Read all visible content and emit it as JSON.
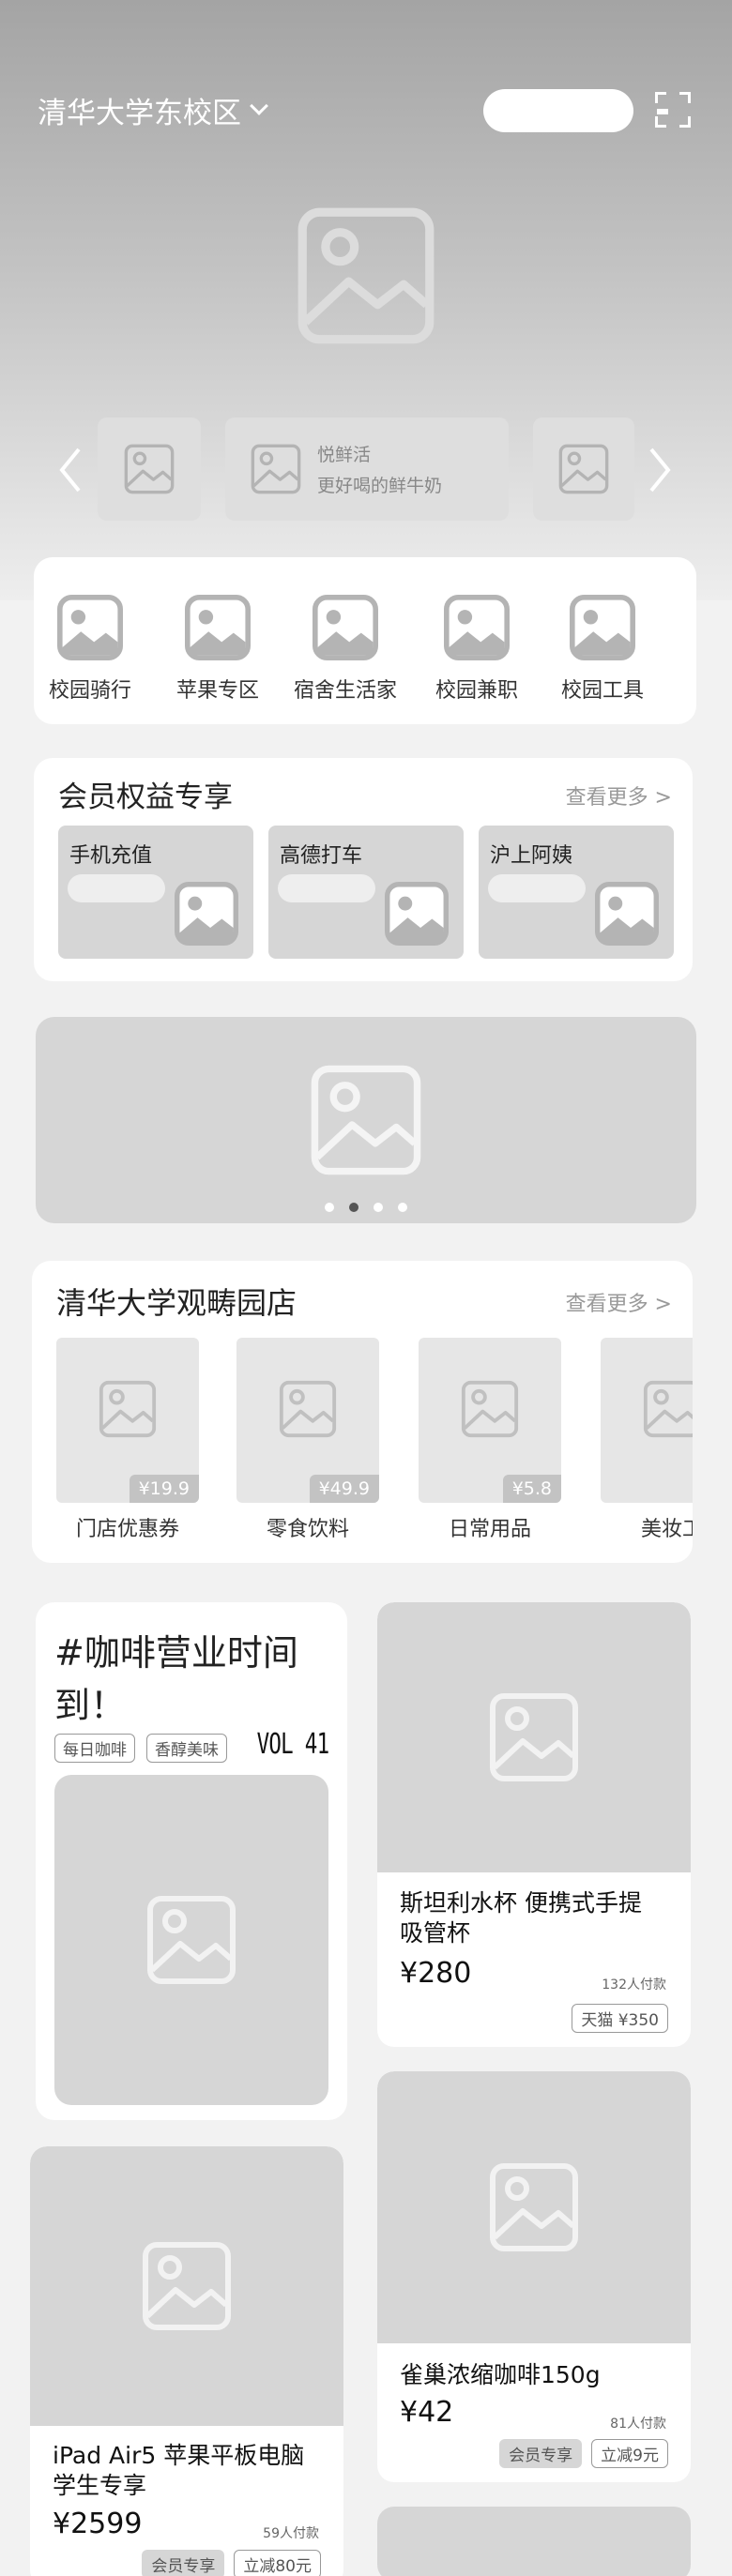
{
  "header": {
    "campus": "清华大学东校区"
  },
  "carousel": {
    "promo_title": "悦鲜活",
    "promo_subtitle": "更好喝的鲜牛奶"
  },
  "categories": [
    {
      "label": "校园骑行",
      "icon": "image-placeholder-icon"
    },
    {
      "label": "苹果专区",
      "icon": "image-placeholder-icon"
    },
    {
      "label": "宿舍生活家",
      "icon": "image-placeholder-icon"
    },
    {
      "label": "校园兼职",
      "icon": "image-placeholder-icon"
    },
    {
      "label": "校园工具",
      "icon": "image-placeholder-icon"
    }
  ],
  "member": {
    "title": "会员权益专享",
    "more": "查看更多 >",
    "cards": [
      {
        "label": "手机充值"
      },
      {
        "label": "高德打车"
      },
      {
        "label": "沪上阿姨"
      }
    ]
  },
  "banner": {
    "dots": 4,
    "active_dot": 1
  },
  "store": {
    "title": "清华大学观畴园店",
    "more": "查看更多 >",
    "items": [
      {
        "name": "门店优惠券",
        "price": "¥19.9"
      },
      {
        "name": "零食饮料",
        "price": "¥49.9"
      },
      {
        "name": "日常用品",
        "price": "¥5.8"
      },
      {
        "name": "美妆工",
        "price": ""
      }
    ]
  },
  "coffee": {
    "title": "#咖啡营业时间到！",
    "tags": [
      "每日咖啡",
      "香醇美味"
    ],
    "vol": "VOL 41"
  },
  "products": [
    {
      "name": "斯坦利水杯 便携式手提吸管杯",
      "price": "¥280",
      "sold": "132人付款",
      "badges": [
        {
          "text": "天猫 ¥350",
          "style": "line"
        }
      ]
    },
    {
      "name": "iPad Air5 苹果平板电脑学生专享",
      "price": "¥2599",
      "sold": "59人付款",
      "badges": [
        {
          "text": "会员专享",
          "style": "fill"
        },
        {
          "text": "立减80元",
          "style": "line"
        }
      ]
    },
    {
      "name": "雀巢浓缩咖啡150g",
      "price": "¥42",
      "sold": "81人付款",
      "badges": [
        {
          "text": "会员专享",
          "style": "fill"
        },
        {
          "text": "立减9元",
          "style": "line"
        }
      ]
    }
  ],
  "colors": {
    "page_bg": "#f2f2f2",
    "placeholder": "#d6d6d6",
    "header_gradient_top": "#a4a4a4"
  }
}
